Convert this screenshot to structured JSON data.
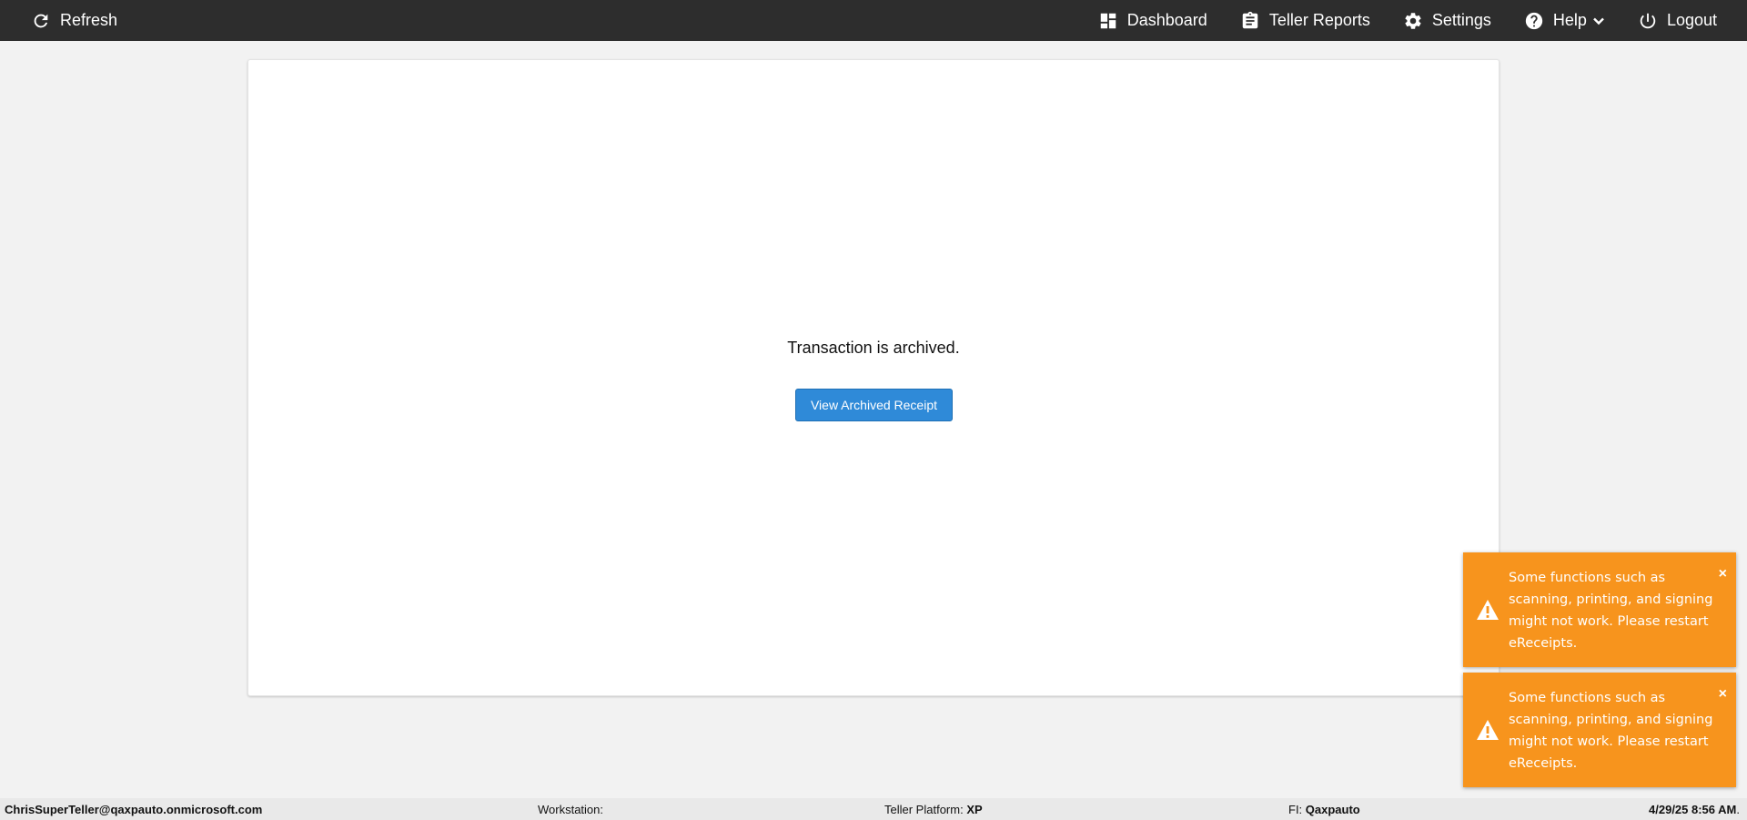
{
  "topbar": {
    "refresh_label": "Refresh",
    "dashboard_label": "Dashboard",
    "teller_reports_label": "Teller Reports",
    "settings_label": "Settings",
    "help_label": "Help",
    "logout_label": "Logout"
  },
  "main": {
    "message": "Transaction is archived.",
    "view_receipt_label": "View Archived Receipt"
  },
  "toasts": [
    {
      "message": "Some functions such as scanning, printing, and signing might not work. Please restart eReceipts.",
      "close": "×"
    },
    {
      "message": "Some functions such as scanning, printing, and signing might not work. Please restart eReceipts.",
      "close": "×"
    }
  ],
  "statusbar": {
    "user": "ChrisSuperTeller@qaxpauto.onmicrosoft.com",
    "workstation_label": "Workstation:",
    "workstation_value": "",
    "platform_label": "Teller Platform:",
    "platform_value": "XP",
    "fi_label": "FI:",
    "fi_value": "Qaxpauto",
    "datetime": "4/29/25 8:56 AM",
    "datetime_suffix": "."
  },
  "colors": {
    "topbar": "#2d2d2d",
    "primary_button": "#2f8ad8",
    "toast_warning": "#f7941d",
    "background": "#f2f2f2"
  }
}
